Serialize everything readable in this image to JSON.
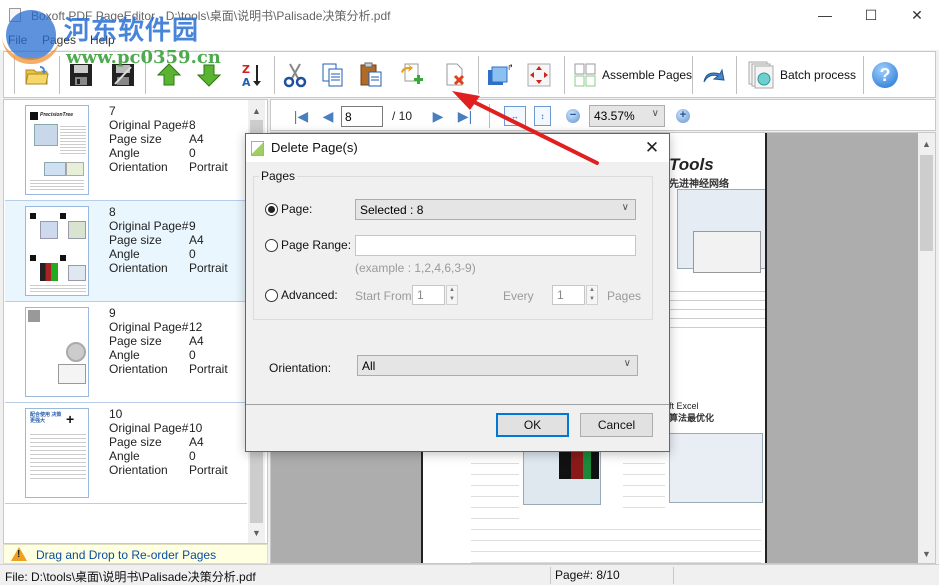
{
  "window": {
    "title": "Boxoft PDF PageEditor - D:\\tools\\桌面\\说明书\\Palisade决策分析.pdf",
    "minimize": "—",
    "maximize": "☐",
    "close": "✕"
  },
  "watermark": {
    "brand": "河东软件园",
    "url": "www.pc0359.cn"
  },
  "menu": [
    "File",
    "Pages",
    "Help"
  ],
  "toolbar": {
    "buttons": [
      {
        "name": "open",
        "icon": "folder-open-icon"
      },
      {
        "name": "save",
        "icon": "save-icon"
      },
      {
        "name": "save-as",
        "icon": "save-as-icon"
      },
      {
        "name": "move-up",
        "icon": "arrow-up-icon"
      },
      {
        "name": "move-down",
        "icon": "arrow-down-icon"
      },
      {
        "name": "sort",
        "icon": "sort-za-icon"
      },
      {
        "name": "cut",
        "icon": "scissors-icon"
      },
      {
        "name": "copy",
        "icon": "copy-icon"
      },
      {
        "name": "paste",
        "icon": "paste-icon"
      },
      {
        "name": "insert",
        "icon": "insert-page-icon"
      },
      {
        "name": "delete",
        "icon": "delete-page-icon"
      },
      {
        "name": "rotate",
        "icon": "rotate-page-icon"
      },
      {
        "name": "crop",
        "icon": "crop-move-icon"
      },
      {
        "name": "undo",
        "icon": "undo-icon"
      },
      {
        "name": "help",
        "icon": "help-icon"
      }
    ],
    "assemble_label": "Assemble Pages",
    "batch_label": "Batch process",
    "help_glyph": "?"
  },
  "thumbnails": {
    "labels": {
      "original": "Original Page#",
      "size": "Page size",
      "angle": "Angle",
      "orientation": "Orientation"
    },
    "items": [
      {
        "index": "7",
        "original": "8",
        "size": "A4",
        "angle": "0",
        "orientation": "Portrait",
        "selected": false
      },
      {
        "index": "8",
        "original": "9",
        "size": "A4",
        "angle": "0",
        "orientation": "Portrait",
        "selected": true
      },
      {
        "index": "9",
        "original": "12",
        "size": "A4",
        "angle": "0",
        "orientation": "Portrait",
        "selected": false
      },
      {
        "index": "10",
        "original": "10",
        "size": "A4",
        "angle": "0",
        "orientation": "Portrait",
        "selected": false
      }
    ],
    "thumb_texts": {
      "t7": "PrecisionTree",
      "t10": "配合使用 决策更强大"
    }
  },
  "hint": {
    "text": "Drag and Drop to Re-order Pages"
  },
  "viewer": {
    "current_page": "8",
    "total_pages": "/ 10",
    "zoom": "43.57%",
    "page_snippets": {
      "heading1": "Tools",
      "sub1": "先进神经网络",
      "heading2": "ft Excel",
      "sub2": "算法最优化"
    }
  },
  "dialog": {
    "title": "Delete Page(s)",
    "group_label": "Pages",
    "page_label": "Page:",
    "page_value": "Selected : 8",
    "range_label": "Page Range:",
    "range_value": "",
    "range_example": "(example : 1,2,4,6,3-9)",
    "advanced_label": "Advanced:",
    "start_from_label": "Start From",
    "start_from_value": "1",
    "every_label": "Every",
    "every_value": "1",
    "pages_suffix": "Pages",
    "orientation_label": "Orientation:",
    "orientation_value": "All",
    "ok_label": "OK",
    "cancel_label": "Cancel",
    "selected_option": "page"
  },
  "status": {
    "file": "File: D:\\tools\\桌面\\说明书\\Palisade决策分析.pdf",
    "page": "Page#: 8/10"
  }
}
